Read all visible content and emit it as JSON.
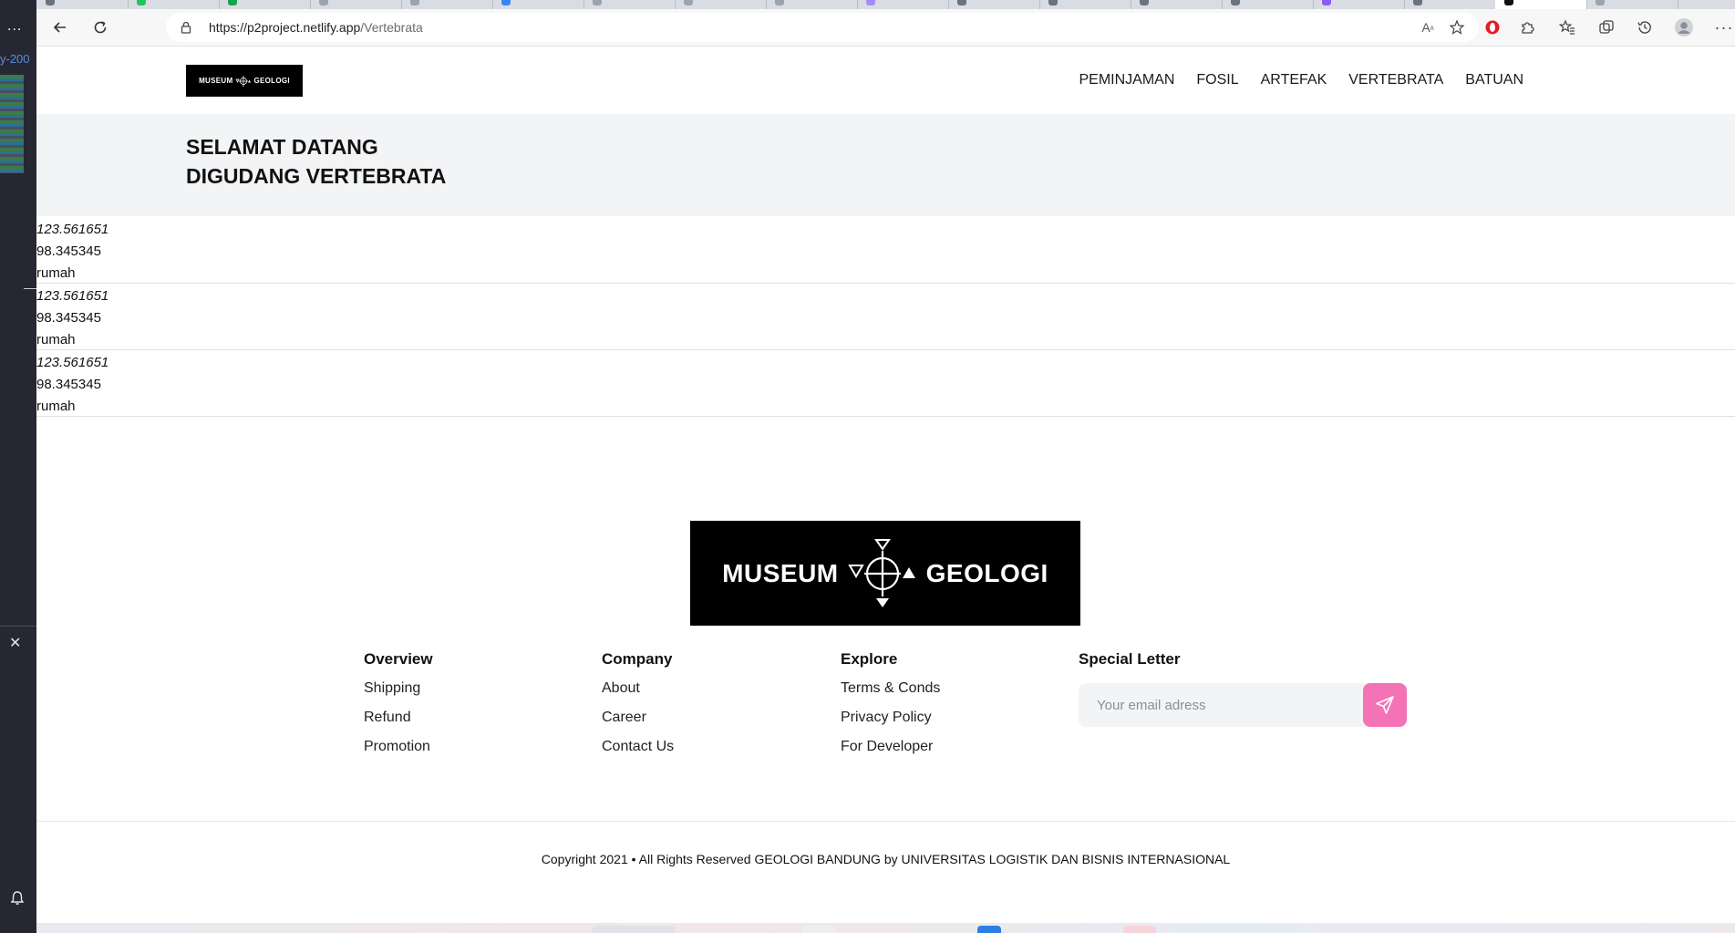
{
  "browser": {
    "url_host": "https://p2project.netlify.app",
    "url_path": "/Vertebrata"
  },
  "sidebar": {
    "more": "...",
    "ref_text": "y-200"
  },
  "site": {
    "nav": [
      "PEMINJAMAN",
      "FOSIL",
      "ARTEFAK",
      "VERTEBRATA",
      "BATUAN"
    ],
    "logo_text_left": "MUSEUM",
    "logo_text_right": "GEOLOGI",
    "hero_line1": "SELAMAT DATANG",
    "hero_line2": "DIGUDANG VERTEBRATA"
  },
  "rows": [
    {
      "a": "123.561651",
      "b": "98.345345",
      "c": "rumah"
    },
    {
      "a": "123.561651",
      "b": "98.345345",
      "c": "rumah"
    },
    {
      "a": "123.561651",
      "b": "98.345345",
      "c": "rumah"
    }
  ],
  "footer": {
    "overview": {
      "title": "Overview",
      "links": [
        "Shipping",
        "Refund",
        "Promotion"
      ]
    },
    "company": {
      "title": "Company",
      "links": [
        "About",
        "Career",
        "Contact Us"
      ]
    },
    "explore": {
      "title": "Explore",
      "links": [
        "Terms & Conds",
        "Privacy Policy",
        "For Developer"
      ]
    },
    "special": {
      "title": "Special Letter",
      "email_placeholder": "Your email adress"
    },
    "copyright": "Copyright 2021 • All Rights Reserved GEOLOGI BANDUNG by UNIVERSITAS LOGISTIK DAN BISNIS INTERNASIONAL"
  },
  "colors": {
    "accent_pink": "#f472b6",
    "hero_bg": "#f3f4f6",
    "logo_bg": "#000000"
  }
}
